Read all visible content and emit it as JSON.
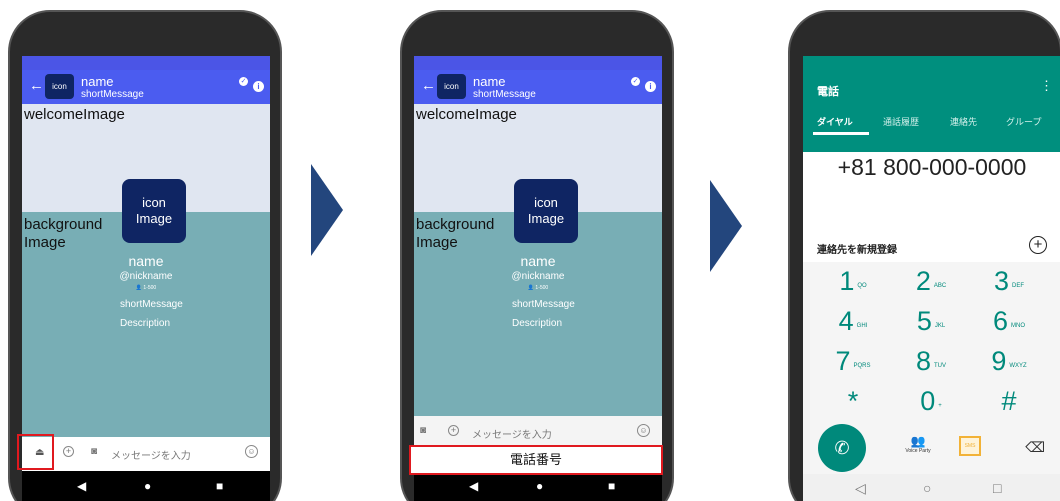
{
  "screen1": {
    "header": {
      "back": "←",
      "icon_label": "icon",
      "name": "name",
      "short": "shortMessage",
      "check": "✓",
      "info": "i"
    },
    "welcome": "welcomeImage",
    "background": [
      "background",
      "Image"
    ],
    "icon_image": [
      "icon",
      "Image"
    ],
    "profile": {
      "name": "name",
      "nickname": "@nickname",
      "count": "👤 1-500",
      "short": "shortMessage",
      "description": "Description"
    },
    "input": {
      "up": "⏏",
      "plus": "+",
      "camera": "◙",
      "placeholder": "メッセージを入力",
      "emoji": "☺"
    },
    "nav": [
      "◀",
      "●",
      "■"
    ]
  },
  "screen2": {
    "header": {
      "back": "←",
      "icon_label": "icon",
      "name": "name",
      "short": "shortMessage",
      "check": "✓",
      "info": "i"
    },
    "welcome": "welcomeImage",
    "background": [
      "background",
      "Image"
    ],
    "icon_image": [
      "icon",
      "Image"
    ],
    "profile": {
      "name": "name",
      "nickname": "@nickname",
      "count": "👤 1-500",
      "short": "shortMessage",
      "description": "Description"
    },
    "input": {
      "up": "⏏",
      "plus": "+",
      "camera": "◙",
      "placeholder": "メッセージを入力",
      "emoji": "☺"
    },
    "phone_button": "電話番号",
    "nav": [
      "◀",
      "●",
      "■"
    ]
  },
  "dialer": {
    "title": "電話",
    "menu": "⋮",
    "tabs": [
      "ダイヤル",
      "通話履歴",
      "連絡先",
      "グループ"
    ],
    "number": "+81 800-000-0000",
    "new_contact": "連絡先を新規登録",
    "add": "+",
    "keys": [
      {
        "d": "1",
        "l": "QO"
      },
      {
        "d": "2",
        "l": "ABC"
      },
      {
        "d": "3",
        "l": "DEF"
      },
      {
        "d": "4",
        "l": "GHI"
      },
      {
        "d": "5",
        "l": "JKL"
      },
      {
        "d": "6",
        "l": "MNO"
      },
      {
        "d": "7",
        "l": "PQRS"
      },
      {
        "d": "8",
        "l": "TUV"
      },
      {
        "d": "9",
        "l": "WXYZ"
      },
      {
        "d": "*",
        "l": ""
      },
      {
        "d": "0",
        "l": "+"
      },
      {
        "d": "#",
        "l": ""
      }
    ],
    "call": "✆",
    "voice_party": "Voice Party",
    "sms": "SMS",
    "delete": "⌫",
    "nav": [
      "◁",
      "○",
      "□"
    ]
  },
  "colors": {
    "header": "#4b5cf0",
    "teal": "#008f7e",
    "arrow": "#23467d",
    "highlight": "#e0191f"
  }
}
